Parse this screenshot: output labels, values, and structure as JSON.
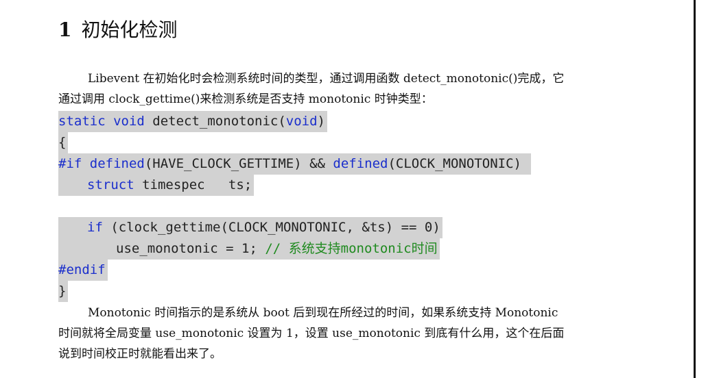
{
  "heading": {
    "number": "1",
    "title": "初始化检测"
  },
  "intro": {
    "line1": "Libevent 在初始化时会检测系统时间的类型，通过调用函数 detect_monotonic()完成，它",
    "line2": "通过调用 clock_gettime()来检测系统是否支持 monotonic 时钟类型："
  },
  "code": {
    "l1": {
      "kw1": "static",
      "kw2": "void",
      "rest": " detect_monotonic(",
      "kw3": "void",
      "end": ")"
    },
    "l2": "{",
    "l3": {
      "kw1": "#if",
      "kw2": "defined",
      "mid": "(HAVE_CLOCK_GETTIME) && ",
      "kw3": "defined",
      "end": "(CLOCK_MONOTONIC) "
    },
    "l4": {
      "kw": "struct",
      "rest": " timespec   ts;"
    },
    "l6": {
      "kw": "if",
      "rest": " (clock_gettime(CLOCK_MONOTONIC, &ts) == 0)"
    },
    "l7": {
      "code": "use_monotonic = 1; ",
      "comment": "// 系统支持monotonic时间"
    },
    "l8": "#endif",
    "l9": "}"
  },
  "outro": {
    "line1": "Monotonic 时间指示的是系统从 boot 后到现在所经过的时间，如果系统支持 Monotonic",
    "line2": "时间就将全局变量 use_monotonic 设置为 1，设置 use_monotonic 到底有什么用，这个在后面",
    "line3": "说到时间校正时就能看出来了。"
  }
}
